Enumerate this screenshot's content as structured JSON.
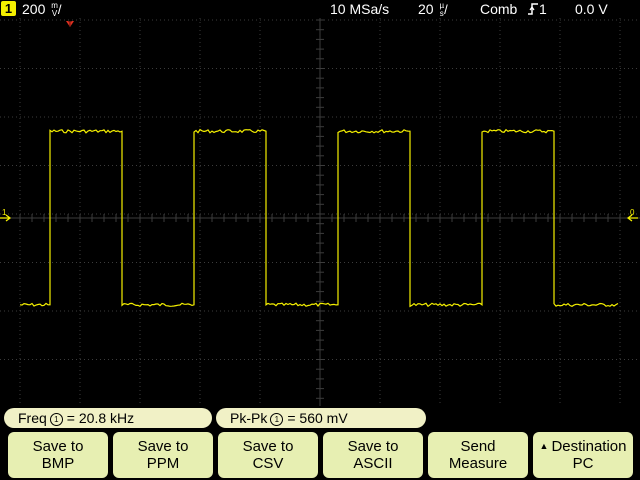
{
  "status": {
    "channel": "1",
    "vertical_scale_value": "200",
    "vertical_unit_top": "m",
    "vertical_unit_bottom": "V",
    "sample_rate": "10 MSa/s",
    "time_scale_value": "20",
    "time_unit_top": "µ",
    "time_unit_bottom": "s",
    "trigger_mode": "Comb",
    "trigger_channel": "1",
    "trigger_level": "0.0 V"
  },
  "markers": {
    "ground_left": "1",
    "trigger_right": "0"
  },
  "measurements": {
    "freq": {
      "label": "Freq",
      "channel": "1",
      "value": "20.8 kHz"
    },
    "pkpk": {
      "label": "Pk-Pk",
      "channel": "1",
      "value": "560 mV"
    }
  },
  "softkeys": [
    {
      "line1": "Save to",
      "line2": "BMP"
    },
    {
      "line1": "Save to",
      "line2": "PPM"
    },
    {
      "line1": "Save to",
      "line2": "CSV"
    },
    {
      "line1": "Save to",
      "line2": "ASCII"
    },
    {
      "line1": "Send",
      "line2": "Measure"
    },
    {
      "line1": "Destination",
      "line2": "PC"
    }
  ],
  "colors": {
    "trace": "#f5f000",
    "grid": "#3c3c3c",
    "softkey": "#e7efb2",
    "measure_pill": "#f1f1c6"
  },
  "icons": {
    "trigger_edge": "rising-edge-icon",
    "trigger_position": "trigger-position-marker-icon",
    "ground": "channel-ground-marker-icon",
    "trigger_level": "trigger-level-marker-icon",
    "menu_arrow": "up-triangle-icon"
  },
  "waveform": {
    "type": "square",
    "high_level_mV": 280,
    "low_level_mV": -280,
    "period_us": 48,
    "duty": 0.5
  }
}
